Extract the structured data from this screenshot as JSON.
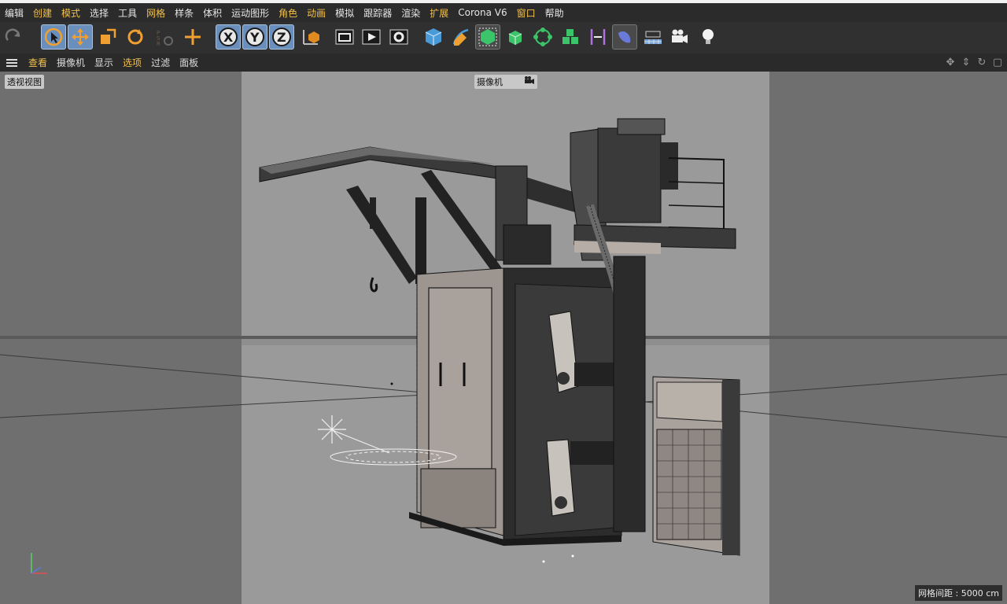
{
  "menu": {
    "items": [
      {
        "label": "编辑",
        "hl": false
      },
      {
        "label": "创建",
        "hl": true
      },
      {
        "label": "模式",
        "hl": true
      },
      {
        "label": "选择",
        "hl": false
      },
      {
        "label": "工具",
        "hl": false
      },
      {
        "label": "网格",
        "hl": true
      },
      {
        "label": "样条",
        "hl": false
      },
      {
        "label": "体积",
        "hl": false
      },
      {
        "label": "运动图形",
        "hl": false
      },
      {
        "label": "角色",
        "hl": true
      },
      {
        "label": "动画",
        "hl": true
      },
      {
        "label": "模拟",
        "hl": false
      },
      {
        "label": "跟踪器",
        "hl": false
      },
      {
        "label": "渲染",
        "hl": false
      },
      {
        "label": "扩展",
        "hl": true
      },
      {
        "label": "Corona V6",
        "hl": false
      },
      {
        "label": "窗口",
        "hl": true
      },
      {
        "label": "帮助",
        "hl": false
      }
    ]
  },
  "toolbar": {
    "tools": [
      {
        "name": "redo-icon",
        "glyph": "↪"
      },
      {
        "name": "live-select-icon"
      },
      {
        "name": "move-icon"
      },
      {
        "name": "scale-icon"
      },
      {
        "name": "rotate-icon"
      },
      {
        "name": "psr-icon",
        "label": "PSR"
      },
      {
        "name": "recent-tools-icon"
      },
      {
        "name": "x-axis-lock-icon",
        "label": "X"
      },
      {
        "name": "y-axis-lock-icon",
        "label": "Y"
      },
      {
        "name": "z-axis-lock-icon",
        "label": "Z"
      },
      {
        "name": "coordinate-system-icon"
      },
      {
        "name": "render-view-icon"
      },
      {
        "name": "render-to-picture-viewer-icon"
      },
      {
        "name": "render-settings-icon"
      },
      {
        "name": "cube-icon"
      },
      {
        "name": "pen-icon"
      },
      {
        "name": "subdivision-surface-icon"
      },
      {
        "name": "extrude-icon"
      },
      {
        "name": "cloner-icon"
      },
      {
        "name": "mograph-icon"
      },
      {
        "name": "deformer-icon"
      },
      {
        "name": "scene-icon"
      },
      {
        "name": "floor-icon"
      },
      {
        "name": "camera-icon"
      },
      {
        "name": "light-icon"
      }
    ]
  },
  "viewport_menu": {
    "items": [
      {
        "label": "查看",
        "hl": true
      },
      {
        "label": "摄像机",
        "hl": false
      },
      {
        "label": "显示",
        "hl": false
      },
      {
        "label": "选项",
        "hl": true
      },
      {
        "label": "过滤",
        "hl": false
      },
      {
        "label": "面板",
        "hl": false
      }
    ]
  },
  "viewport": {
    "view_name": "透视视图",
    "camera_label": "摄像机",
    "grid_spacing": "网格间距 : 5000 cm"
  },
  "colors": {
    "accent_orange": "#f0a030",
    "active_blue": "#6a8fbd",
    "background_dark": "#2b2b2b",
    "viewport_grey": "#8a8a8a"
  }
}
